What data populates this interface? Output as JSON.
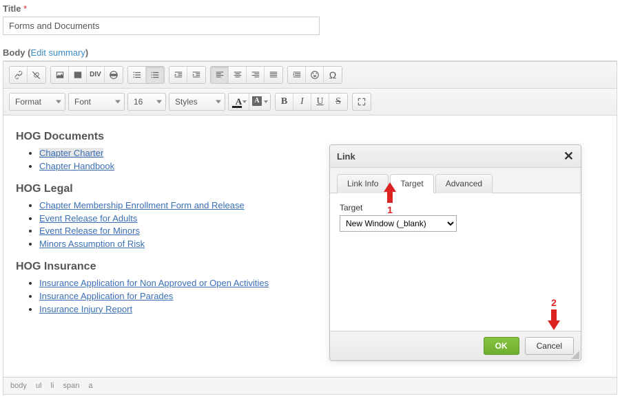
{
  "title": {
    "label": "Title",
    "required": "*",
    "value": "Forms and Documents"
  },
  "body_label": "Body",
  "edit_summary": "Edit summary",
  "toolbar2": {
    "format": "Format",
    "font": "Font",
    "size": "16",
    "styles": "Styles"
  },
  "content": {
    "h1": "HOG Documents",
    "list1": [
      "Chapter Charter",
      "Chapter Handbook"
    ],
    "h2": "HOG Legal",
    "list2": [
      "Chapter Membership Enrollment Form and Release",
      "Event Release for Adults",
      "Event Release for Minors",
      "Minors Assumption of Risk"
    ],
    "h3": "HOG Insurance",
    "list3": [
      "Insurance Application for Non Approved or Open Activities",
      "Insurance Application for Parades",
      "Insurance Injury Report"
    ]
  },
  "path": [
    "body",
    "ul",
    "li",
    "span",
    "a"
  ],
  "dialog": {
    "title": "Link",
    "tabs": {
      "info": "Link Info",
      "target": "Target",
      "advanced": "Advanced"
    },
    "target_label": "Target",
    "target_value": "New Window (_blank)",
    "ok": "OK",
    "cancel": "Cancel"
  },
  "anno": {
    "n1": "1",
    "n2": "2"
  }
}
